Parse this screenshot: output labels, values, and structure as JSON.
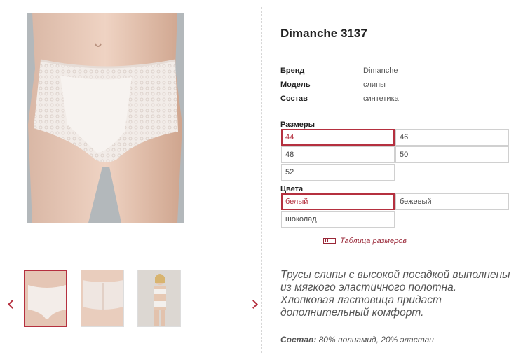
{
  "product": {
    "title": "Dimanche 3137",
    "attributes": [
      {
        "key": "Бренд",
        "value": "Dimanche"
      },
      {
        "key": "Модель",
        "value": "слипы"
      },
      {
        "key": "Состав",
        "value": "синтетика"
      }
    ]
  },
  "sizes": {
    "label": "Размеры",
    "options": [
      "44",
      "46",
      "48",
      "50",
      "52"
    ],
    "selected": "44"
  },
  "colors": {
    "label": "Цвета",
    "options": [
      "белый",
      "бежевый",
      "шоколад"
    ],
    "selected": "белый"
  },
  "size_table_link": "Таблица размеров",
  "description": "Трусы слипы с высокой посадкой выполнены из мягкого эластичного полотна. Хлопковая ластовица придаст дополнительный комфорт.",
  "composition": {
    "label": "Состав:",
    "value": "80% полиамид, 20% эластан"
  },
  "icons": {
    "prev": "chevron-left-icon",
    "next": "chevron-right-icon",
    "size_table": "ruler-icon"
  },
  "theme": {
    "accent": "#b5303f",
    "divider": "#7a2a32"
  }
}
